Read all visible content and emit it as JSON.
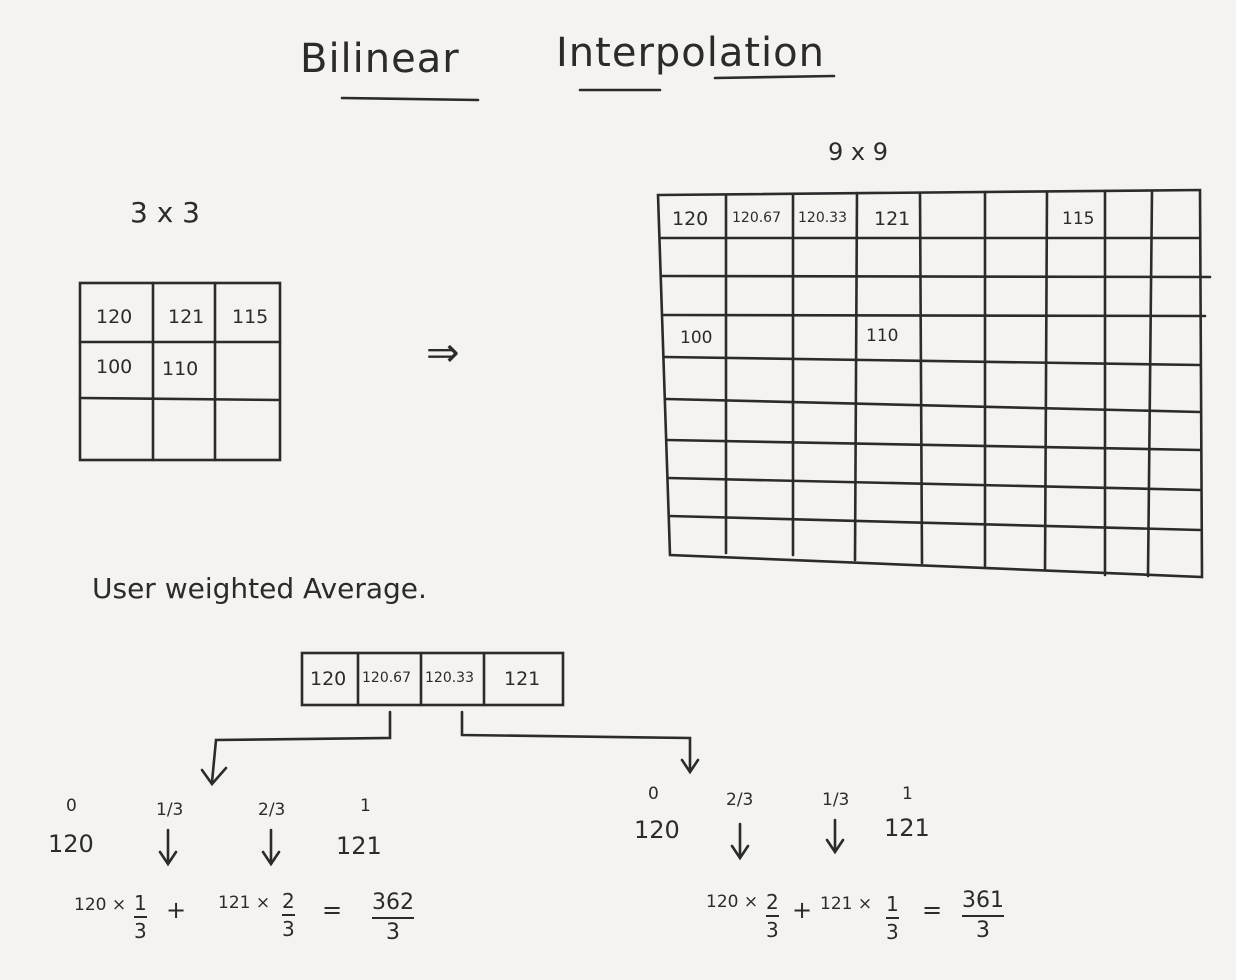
{
  "title": {
    "word1": "Bilinear",
    "word2": "Interpolation"
  },
  "small_grid": {
    "label": "3 x 3",
    "rows": [
      [
        "120",
        "121",
        "115"
      ],
      [
        "100",
        "110",
        ""
      ],
      [
        "",
        "",
        ""
      ]
    ]
  },
  "arrow": "⇒",
  "big_grid": {
    "label": "9 x 9",
    "rows": [
      [
        "120",
        "120.67",
        "120.33",
        "121",
        "",
        "",
        "115",
        "",
        ""
      ],
      [
        "",
        "",
        "",
        "",
        "",
        "",
        "",
        "",
        ""
      ],
      [
        "",
        "",
        "",
        "",
        "",
        "",
        "",
        "",
        ""
      ],
      [
        "100",
        "",
        "",
        "110",
        "",
        "",
        "",
        "",
        ""
      ]
    ]
  },
  "note": "User weighted Average.",
  "strip": [
    "120",
    "120.67",
    "120.33",
    "121"
  ],
  "left_calc": {
    "weights": [
      "0",
      "1/3",
      "2/3",
      "1"
    ],
    "values": [
      "120",
      "121"
    ],
    "expr_a": "120 ×",
    "frac_a": {
      "num": "1",
      "den": "3"
    },
    "plus": "+",
    "expr_b": "121 ×",
    "frac_b": {
      "num": "2",
      "den": "3"
    },
    "eq": "=",
    "result": {
      "num": "362",
      "den": "3"
    }
  },
  "right_calc": {
    "weights": [
      "0",
      "2/3",
      "1/3",
      "1"
    ],
    "values": [
      "120",
      "121"
    ],
    "expr_a": "120 ×",
    "frac_a": {
      "num": "2",
      "den": "3"
    },
    "plus": "+",
    "expr_b": "121 ×",
    "frac_b": {
      "num": "1",
      "den": "3"
    },
    "eq": "=",
    "result": {
      "num": "361",
      "den": "3"
    }
  }
}
